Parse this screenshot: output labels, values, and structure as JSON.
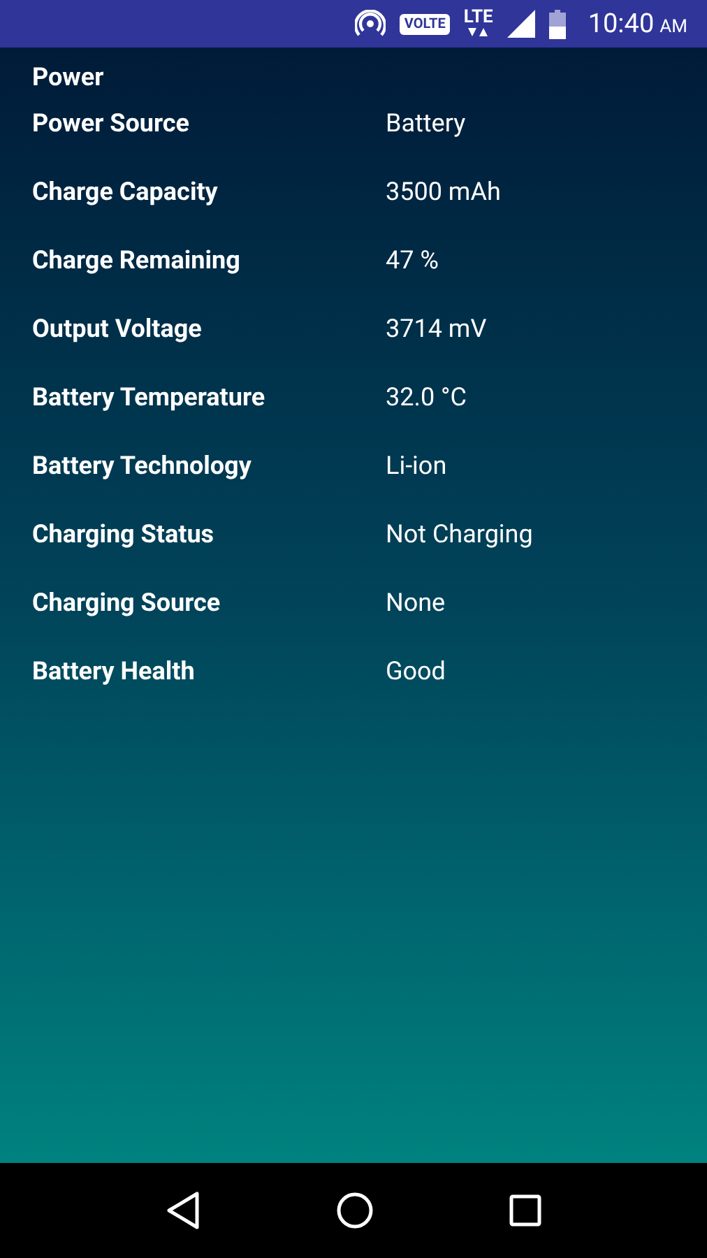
{
  "status_bar": {
    "volte": "VOLTE",
    "network": "LTE",
    "time": "10:40",
    "ampm": "AM"
  },
  "section_title": "Power",
  "rows": [
    {
      "label": "Power Source",
      "value": "Battery"
    },
    {
      "label": "Charge Capacity",
      "value": "3500 mAh"
    },
    {
      "label": "Charge Remaining",
      "value": "47 %"
    },
    {
      "label": "Output Voltage",
      "value": "3714 mV"
    },
    {
      "label": "Battery Temperature",
      "value": "32.0 °C"
    },
    {
      "label": "Battery Technology",
      "value": "Li-ion"
    },
    {
      "label": "Charging Status",
      "value": "Not Charging"
    },
    {
      "label": "Charging Source",
      "value": "None"
    },
    {
      "label": "Battery Health",
      "value": "Good"
    }
  ]
}
